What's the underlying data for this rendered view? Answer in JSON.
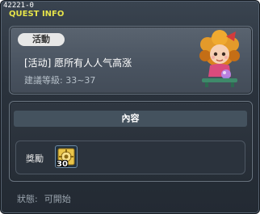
{
  "window": {
    "quest_id": "42221-0",
    "title": "QUEST INFO"
  },
  "quest": {
    "category_badge": "活動",
    "name": "[活动] 愿所有人人气高涨",
    "level_requirement": "建議等級: 33~37"
  },
  "content": {
    "section_title": "內容",
    "reward_label": "獎勵",
    "reward_item": {
      "icon": "gear-chip-icon",
      "count": "30"
    }
  },
  "status": {
    "label": "狀態:",
    "value": "可開始"
  },
  "colors": {
    "title_yellow": "#e6e34a",
    "window_bg": "#2a323c",
    "panel_bg": "#495360"
  }
}
